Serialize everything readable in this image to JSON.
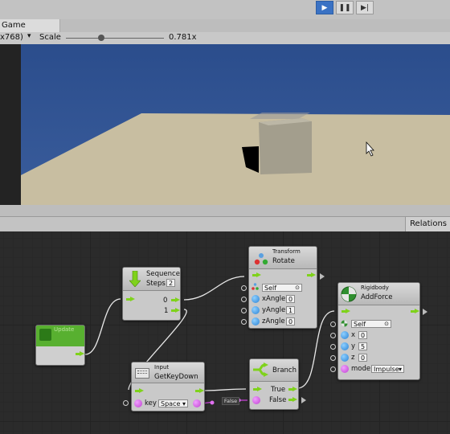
{
  "toolbar": {
    "play_icon": "play-icon",
    "pause_icon": "pause-icon",
    "step_icon": "step-icon"
  },
  "game_view": {
    "tab": "Game",
    "resolution": "x768)",
    "scale_label": "Scale",
    "scale_value": "0.781x",
    "scale_fraction": 0.36
  },
  "panels": {
    "relations_tab": "Relations"
  },
  "nodes": {
    "start": {
      "title": "Update"
    },
    "sequence": {
      "title": "Sequence",
      "steps_label": "Steps",
      "steps_value": "2",
      "out0": "0",
      "out1": "1"
    },
    "transform": {
      "category": "Transform",
      "title": "Rotate",
      "target": "Self",
      "xangle_label": "xAngle",
      "xangle": "0",
      "yangle_label": "yAngle",
      "yangle": "1",
      "zangle_label": "zAngle",
      "zangle": "0"
    },
    "input": {
      "category": "Input",
      "title": "GetKeyDown",
      "key_label": "key",
      "key_value": "Space"
    },
    "branch": {
      "title": "Branch",
      "true_label": "True",
      "false_label": "False"
    },
    "rigidbody": {
      "category": "Rigidbody",
      "title": "AddForce",
      "target": "Self",
      "x_label": "x",
      "x": "0",
      "y_label": "y",
      "y": "5",
      "z_label": "z",
      "z": "0",
      "mode_label": "mode",
      "mode_value": "Impulse"
    },
    "false_literal": {
      "label": "False"
    }
  },
  "colors": {
    "control_flow": "#7fd21b",
    "float_port": "#2a82d4",
    "bool_port": "#c040d0",
    "sky": "#2f4f8e",
    "ground": "#c9bfa0"
  }
}
